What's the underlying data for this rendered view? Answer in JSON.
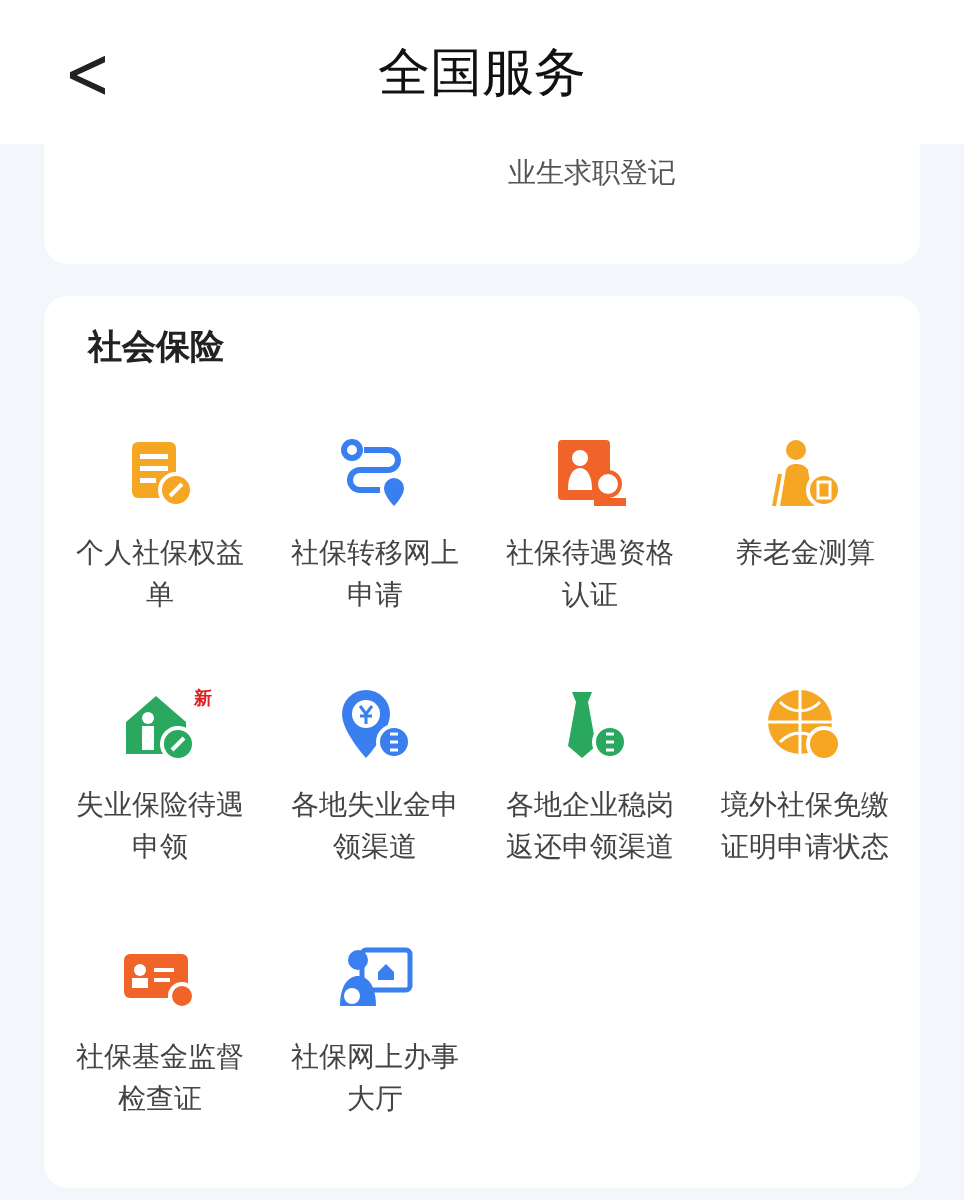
{
  "header": {
    "back": "<",
    "title": "全国服务"
  },
  "top_section": {
    "column_3": "业生求职登记"
  },
  "section": {
    "title": "社会保险",
    "items": [
      {
        "label": "个人社保权益单"
      },
      {
        "label": "社保转移网上申请"
      },
      {
        "label": "社保待遇资格认证"
      },
      {
        "label": "养老金测算"
      },
      {
        "label": "失业保险待遇申领",
        "badge": "新"
      },
      {
        "label": "各地失业金申领渠道"
      },
      {
        "label": "各地企业稳岗返还申领渠道"
      },
      {
        "label": "境外社保免缴证明申请状态"
      },
      {
        "label": "社保基金监督检查证"
      },
      {
        "label": "社保网上办事大厅"
      }
    ]
  }
}
